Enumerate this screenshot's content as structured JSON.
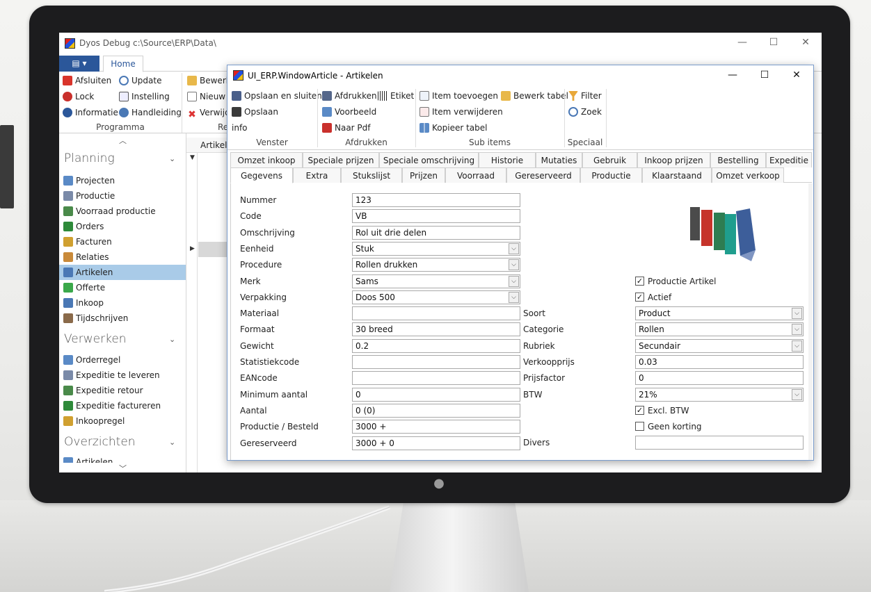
{
  "main_window": {
    "title": "Dyos Debug c:\\Source\\ERP\\Data\\",
    "app_button_label": "▤ ▾",
    "home_tab": "Home",
    "ribbon": {
      "programma": {
        "group_label": "Programma",
        "afsluiten": "Afsluiten",
        "update": "Update",
        "lock": "Lock",
        "instelling": "Instelling",
        "informatie": "Informatie",
        "handleiding": "Handleiding"
      },
      "partial": {
        "bewerk": "Bewerk",
        "nieuw": "Nieuw",
        "verwijder": "Verwijd",
        "group_label": "Re"
      }
    },
    "sidebar": {
      "planning": {
        "header": "Planning",
        "items": [
          "Projecten",
          "Productie",
          "Voorraad productie",
          "Orders",
          "Facturen",
          "Relaties",
          "Artikelen",
          "Offerte",
          "Inkoop",
          "Tijdschrijven"
        ]
      },
      "verwerken": {
        "header": "Verwerken",
        "items": [
          "Orderregel",
          "Expeditie te leveren",
          "Expeditie retour",
          "Expeditie factureren",
          "Inkoopregel"
        ]
      },
      "overzichten": {
        "header": "Overzichten",
        "items": [
          "Artikelen"
        ]
      }
    },
    "grid": {
      "column_header": "Artikel"
    }
  },
  "article_window": {
    "title": "UI_ERP.WindowArticle - Artikelen",
    "ribbon": {
      "venster": {
        "label": "Venster",
        "opslaan_sluiten": "Opslaan en sluiten",
        "opslaan": "Opslaan",
        "info": "info"
      },
      "afdrukken": {
        "label": "Afdrukken",
        "afdrukken": "Afdrukken",
        "etiket": "Etiket",
        "voorbeeld": "Voorbeeld",
        "naar_pdf": "Naar Pdf"
      },
      "sub_items": {
        "label": "Sub items",
        "item_toevoegen": "Item toevoegen",
        "bewerk_tabel": "Bewerk tabel",
        "item_verwijderen": "Item verwijderen",
        "kopieer_tabel": "Kopieer tabel"
      },
      "speciaal": {
        "label": "Speciaal",
        "filter": "Filter",
        "zoek": "Zoek"
      }
    },
    "tabs_row1": [
      "Omzet inkoop",
      "Speciale prijzen",
      "Speciale omschrijving",
      "Historie",
      "Mutaties",
      "Gebruik",
      "Inkoop prijzen",
      "Bestelling",
      "Expeditie"
    ],
    "tabs_row2": [
      "Gegevens",
      "Extra",
      "Stukslijst",
      "Prijzen",
      "Voorraad",
      "Gereserveerd",
      "Productie",
      "Klaarstaand",
      "Omzet verkoop"
    ],
    "active_tab": "Gegevens",
    "form_left": [
      {
        "label": "Nummer",
        "value": "123",
        "type": "text"
      },
      {
        "label": "Code",
        "value": "VB",
        "type": "text"
      },
      {
        "label": "Omschrijving",
        "value": "Rol uit drie delen",
        "type": "text"
      },
      {
        "label": "Eenheid",
        "value": "Stuk",
        "type": "select"
      },
      {
        "label": "Procedure",
        "value": "Rollen drukken",
        "type": "select"
      },
      {
        "label": "Merk",
        "value": "Sams",
        "type": "select"
      },
      {
        "label": "Verpakking",
        "value": "Doos 500",
        "type": "select"
      },
      {
        "label": "Materiaal",
        "value": "",
        "type": "text"
      },
      {
        "label": "Formaat",
        "value": "30 breed",
        "type": "text"
      },
      {
        "label": "Gewicht",
        "value": "0.2",
        "type": "text"
      },
      {
        "label": "Statistiekcode",
        "value": "",
        "type": "text"
      },
      {
        "label": "EANcode",
        "value": "",
        "type": "text"
      },
      {
        "label": "Minimum aantal",
        "value": "0",
        "type": "text"
      },
      {
        "label": "Aantal",
        "value": "0 (0)",
        "type": "text"
      },
      {
        "label": "Productie / Besteld",
        "value": "3000 +",
        "type": "text"
      },
      {
        "label": "Gereserveerd",
        "value": "3000 + 0",
        "type": "text"
      }
    ],
    "form_right": [
      {
        "label": "Soort",
        "value": "Product",
        "type": "select"
      },
      {
        "label": "Categorie",
        "value": "Rollen",
        "type": "select"
      },
      {
        "label": "Rubriek",
        "value": "Secundair",
        "type": "select"
      },
      {
        "label": "Verkoopprijs",
        "value": "0.03",
        "type": "text"
      },
      {
        "label": "Prijsfactor",
        "value": "0",
        "type": "text"
      },
      {
        "label": "BTW",
        "value": "21%",
        "type": "select"
      }
    ],
    "checkboxes": {
      "productie_artikel": {
        "label": "Productie Artikel",
        "checked": true
      },
      "actief": {
        "label": "Actief",
        "checked": true
      },
      "excl_btw": {
        "label": "Excl. BTW",
        "checked": true
      },
      "geen_korting": {
        "label": "Geen korting",
        "checked": false
      }
    },
    "divers": {
      "label": "Divers",
      "value": ""
    }
  },
  "colors": {
    "accent": "#2b579a",
    "selection": "#a9cbe8",
    "bezel": "#1c1c1e"
  }
}
